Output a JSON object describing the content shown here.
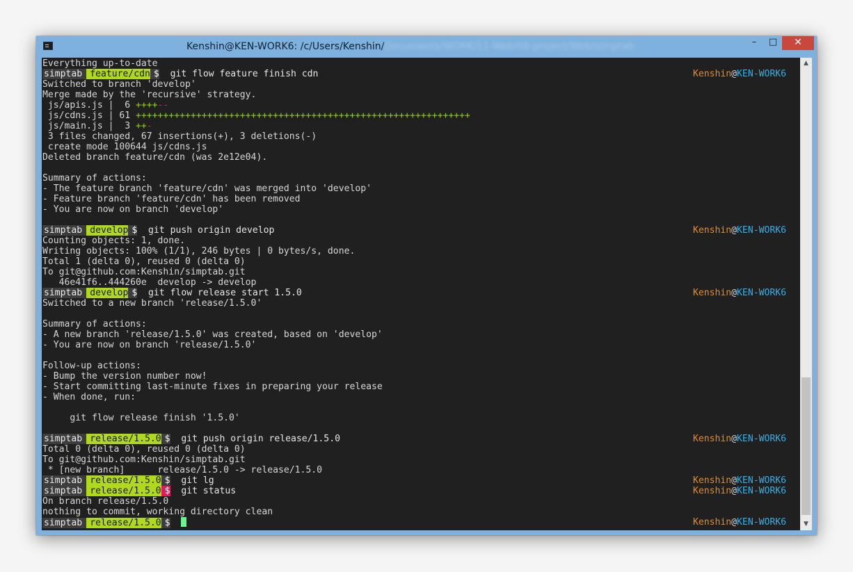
{
  "window": {
    "title": "Kenshin@KEN-WORK6: /c/Users/Kenshin/",
    "title_redacted": "Documents/WORK/11-Web/08-project/Web/simptab",
    "controls": {
      "minimize": "–",
      "maximize": "□",
      "close": "✕"
    }
  },
  "prompt_host": {
    "user": "Kenshin",
    "at": "@",
    "host": "KEN-WORK6"
  },
  "colors": {
    "terminal_bg": "#202020",
    "text": "#d7d7d7",
    "branch_seg": "#b0d81c",
    "dir_seg": "#3d3d3d",
    "error_seg": "#e0195a",
    "rprompt_user": "#f28a16",
    "rprompt_host": "#33b0e8",
    "cursor": "#6af592",
    "titlebar": "#7fb1de",
    "close": "#c9483e"
  },
  "icons": {
    "app": "terminal-icon",
    "scroll_up": "chevron-up-icon",
    "scroll_down": "chevron-down-icon"
  },
  "terminal": {
    "lines": [
      {
        "t": "Everything up-to-date"
      },
      {
        "p": {
          "dir": "simptab",
          "branch": "feature/cdn",
          "dollar": "$",
          "cmd": "git flow feature finish cdn"
        }
      },
      {
        "t": "Switched to branch 'develop'"
      },
      {
        "t": "Merge made by the 'recursive' strategy."
      },
      {
        "t": " js/apis.js |  6 ",
        "plus": "++++",
        "minus": "--"
      },
      {
        "t": " js/cdns.js | 61 ",
        "plus": "+++++++++++++++++++++++++++++++++++++++++++++++++++++++++++++"
      },
      {
        "t": " js/main.js |  3 ",
        "plus": "++",
        "minus": "-"
      },
      {
        "t": " 3 files changed, 67 insertions(+), 3 deletions(-)"
      },
      {
        "t": " create mode 100644 js/cdns.js"
      },
      {
        "t": "Deleted branch feature/cdn (was 2e12e04)."
      },
      {
        "t": ""
      },
      {
        "t": "Summary of actions:"
      },
      {
        "t": "- The feature branch 'feature/cdn' was merged into 'develop'"
      },
      {
        "t": "- Feature branch 'feature/cdn' has been removed"
      },
      {
        "t": "- You are now on branch 'develop'"
      },
      {
        "t": ""
      },
      {
        "p": {
          "dir": "simptab",
          "branch": "develop",
          "dollar": "$",
          "cmd": "git push origin develop"
        }
      },
      {
        "t": "Counting objects: 1, done."
      },
      {
        "t": "Writing objects: 100% (1/1), 246 bytes | 0 bytes/s, done."
      },
      {
        "t": "Total 1 (delta 0), reused 0 (delta 0)"
      },
      {
        "t": "To git@github.com:Kenshin/simptab.git"
      },
      {
        "t": "   46e41f6..444260e  develop -> develop"
      },
      {
        "p": {
          "dir": "simptab",
          "branch": "develop",
          "dollar": "$",
          "cmd": "git flow release start 1.5.0"
        }
      },
      {
        "t": "Switched to a new branch 'release/1.5.0'"
      },
      {
        "t": ""
      },
      {
        "t": "Summary of actions:"
      },
      {
        "t": "- A new branch 'release/1.5.0' was created, based on 'develop'"
      },
      {
        "t": "- You are now on branch 'release/1.5.0'"
      },
      {
        "t": ""
      },
      {
        "t": "Follow-up actions:"
      },
      {
        "t": "- Bump the version number now!"
      },
      {
        "t": "- Start committing last-minute fixes in preparing your release"
      },
      {
        "t": "- When done, run:"
      },
      {
        "t": ""
      },
      {
        "t": "     git flow release finish '1.5.0'"
      },
      {
        "t": ""
      },
      {
        "p": {
          "dir": "simptab",
          "branch": "release/1.5.0",
          "dollar": "$",
          "cmd": "git push origin release/1.5.0"
        }
      },
      {
        "t": "Total 0 (delta 0), reused 0 (delta 0)"
      },
      {
        "t": "To git@github.com:Kenshin/simptab.git"
      },
      {
        "t": " * [new branch]      release/1.5.0 -> release/1.5.0"
      },
      {
        "p": {
          "dir": "simptab",
          "branch": "release/1.5.0",
          "dollar": "$",
          "cmd": "git lg"
        }
      },
      {
        "p": {
          "dir": "simptab",
          "branch": "release/1.5.0",
          "dollar": "$",
          "cmd": "git status",
          "error": true
        }
      },
      {
        "t": "On branch release/1.5.0"
      },
      {
        "t": "nothing to commit, working directory clean"
      },
      {
        "p": {
          "dir": "simptab",
          "branch": "release/1.5.0",
          "dollar": "$",
          "cmd": "",
          "cursor": true
        }
      }
    ]
  }
}
